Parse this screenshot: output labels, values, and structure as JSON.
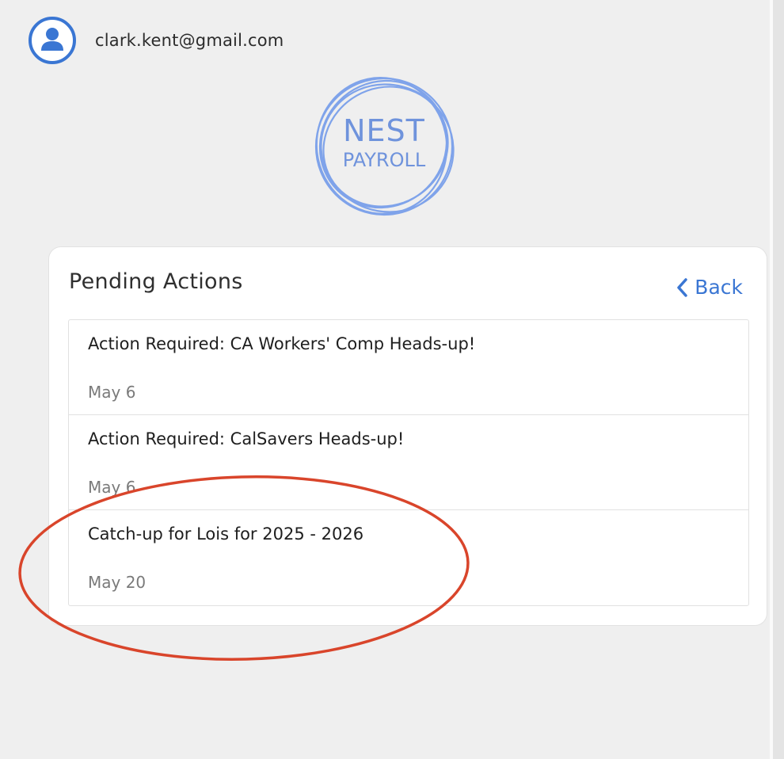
{
  "account": {
    "email": "clark.kent@gmail.com",
    "avatar_icon": "user-circle-icon"
  },
  "logo": {
    "line1": "NEST",
    "line2": "PAYROLL",
    "color": "#7fa3ea"
  },
  "pending": {
    "title": "Pending Actions",
    "back_label": "Back",
    "back_icon": "chevron-left-icon",
    "items": [
      {
        "title": "Action Required: CA Workers' Comp Heads-up!",
        "date": "May 6"
      },
      {
        "title": "Action Required: CalSavers Heads-up!",
        "date": "May 6"
      },
      {
        "title": "Catch-up for Lois for 2025 - 2026",
        "date": "May 20"
      }
    ]
  },
  "colors": {
    "accent": "#3a76d3",
    "annotation": "#d9452b",
    "background": "#efefef"
  }
}
